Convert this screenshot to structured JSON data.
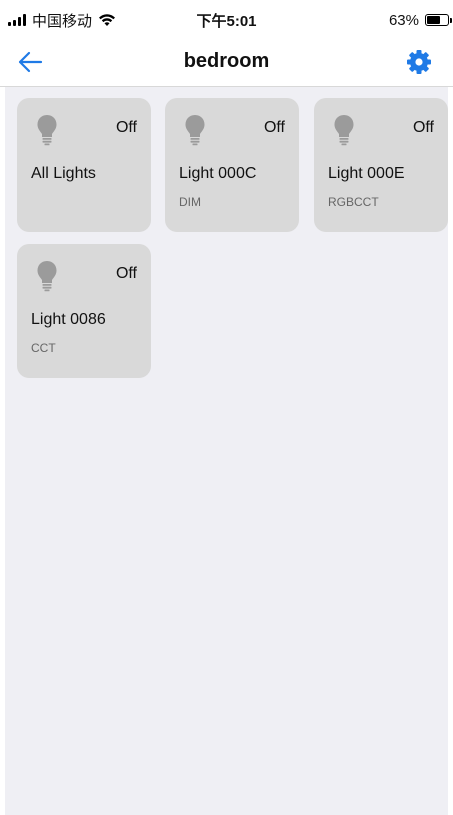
{
  "status_bar": {
    "carrier": "中国移动",
    "time": "下午5:01",
    "battery_percent": "63%",
    "battery_level": 0.63
  },
  "nav": {
    "title": "bedroom",
    "back_icon": "arrow-left-icon",
    "settings_icon": "gear-icon",
    "accent_color": "#1f7ae6"
  },
  "lights": [
    {
      "name": "All Lights",
      "type": "",
      "state": "Off"
    },
    {
      "name": "Light 000C",
      "type": "DIM",
      "state": "Off"
    },
    {
      "name": "Light 000E",
      "type": "RGBCCT",
      "state": "Off"
    },
    {
      "name": "Light 0086",
      "type": "CCT",
      "state": "Off"
    }
  ],
  "colors": {
    "tile_bg": "#d9d9d9",
    "content_bg": "#efeff4",
    "bulb_off": "#9b9b9b"
  }
}
